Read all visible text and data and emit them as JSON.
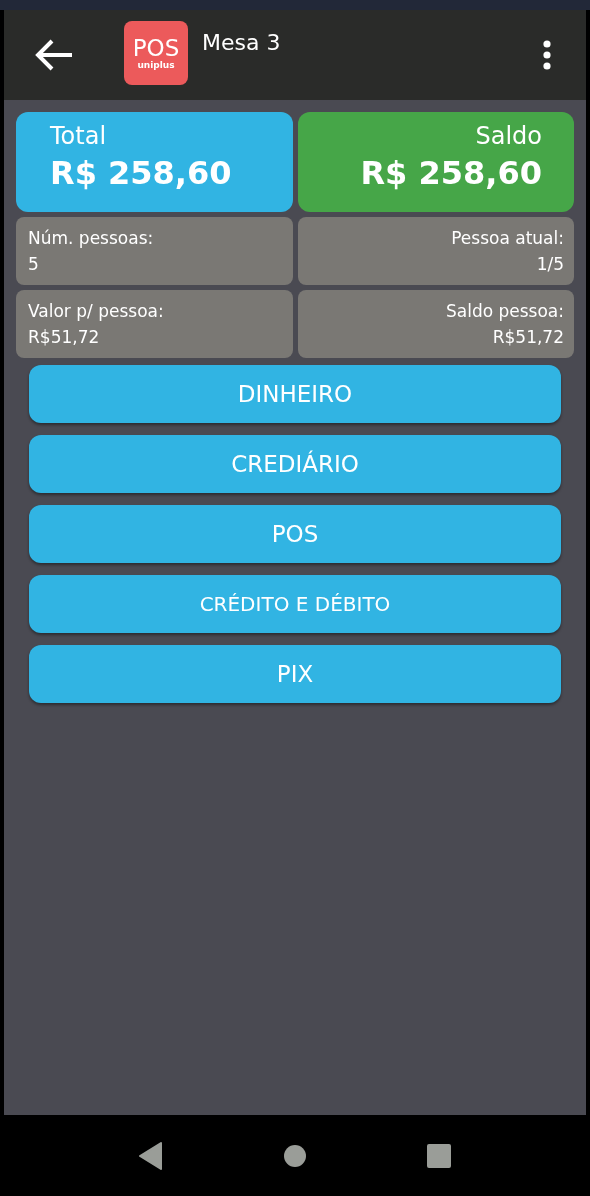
{
  "app_bar": {
    "title": "Mesa 3",
    "logo": {
      "main": "POS",
      "sub": "uniplus"
    }
  },
  "summary": [
    {
      "label": "Total",
      "value": "R$ 258,60",
      "color": "#31b4e3"
    },
    {
      "label": "Saldo",
      "value": "R$ 258,60",
      "color": "#46a648"
    }
  ],
  "details": [
    {
      "label": "Núm. pessoas:",
      "value": "5"
    },
    {
      "label": "Pessoa atual:",
      "value": "1/5"
    },
    {
      "label": "Valor p/ pessoa:",
      "value": "R$51,72"
    },
    {
      "label": "Saldo pessoa:",
      "value": "R$51,72"
    }
  ],
  "payment_buttons": [
    {
      "label": "DINHEIRO"
    },
    {
      "label": "CREDIÁRIO"
    },
    {
      "label": "POS"
    },
    {
      "label": "CRÉDITO E DÉBITO",
      "kind": "small"
    },
    {
      "label": "PIX"
    }
  ]
}
